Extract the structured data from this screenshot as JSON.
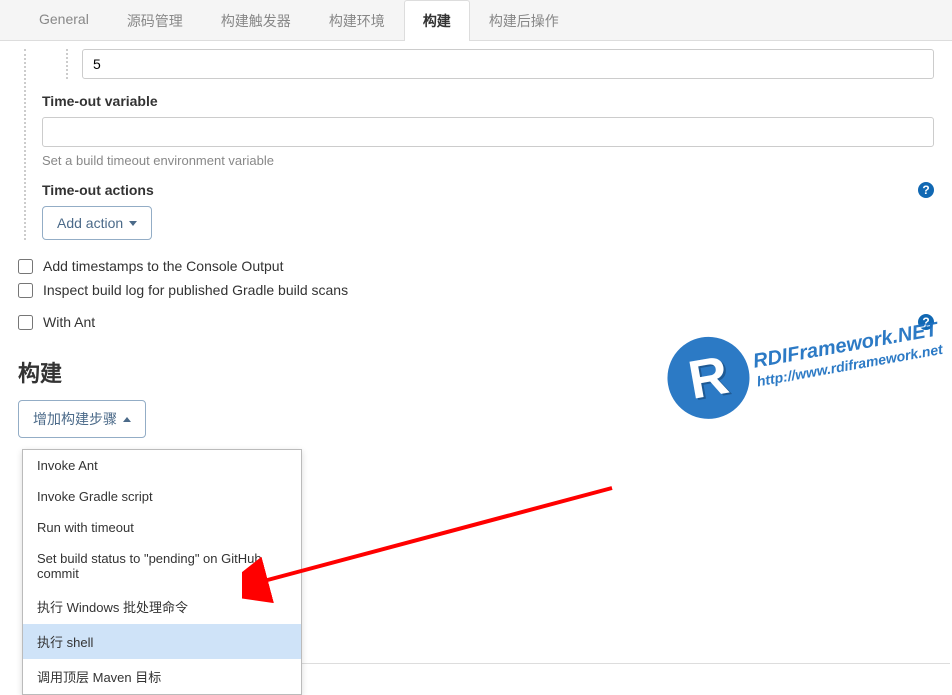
{
  "tabs": {
    "general": "General",
    "scm": "源码管理",
    "triggers": "构建触发器",
    "env": "构建环境",
    "build": "构建",
    "post": "构建后操作"
  },
  "timeout": {
    "value": "5",
    "var_label": "Time-out variable",
    "var_help": "Set a build timeout environment variable",
    "actions_label": "Time-out actions",
    "add_action": "Add action"
  },
  "checks": {
    "timestamps": "Add timestamps to the Console Output",
    "gradle": "Inspect build log for published Gradle build scans",
    "ant": "With Ant"
  },
  "build": {
    "title": "构建",
    "add_step": "增加构建步骤"
  },
  "menu": {
    "items": [
      "Invoke Ant",
      "Invoke Gradle script",
      "Run with timeout",
      "Set build status to \"pending\" on GitHub commit",
      "执行 Windows 批处理命令",
      "执行 shell",
      "调用顶层 Maven 目标"
    ],
    "highlight_index": 5
  },
  "watermark": {
    "logo_letter": "R",
    "line1": "RDIFramework.NET",
    "line2": "http://www.rdiframework.net"
  }
}
